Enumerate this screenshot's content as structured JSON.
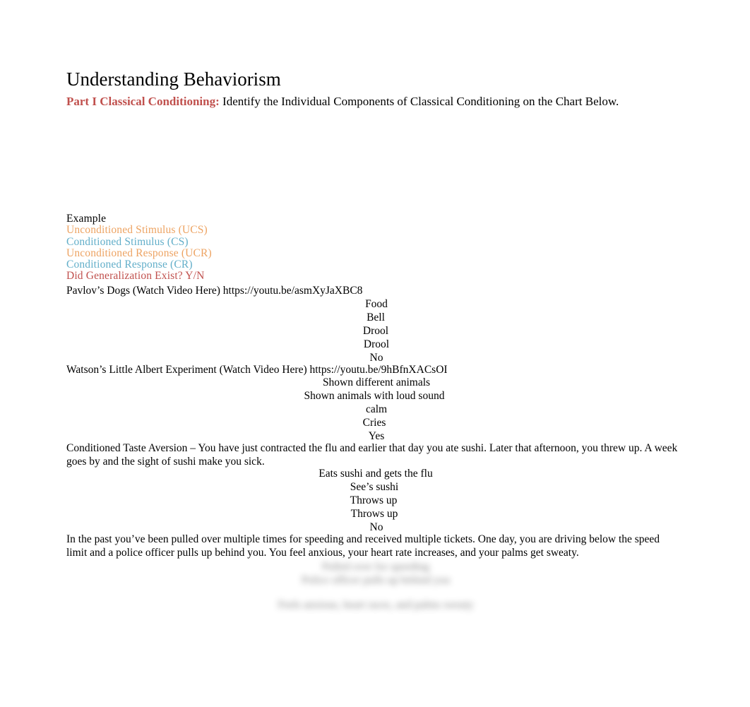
{
  "document": {
    "title": "Understanding Behaviorism",
    "subtitle_lead": "Part I Classical Conditioning:",
    "subtitle_rest": " Identify the Individual Components of Classical Conditioning on the Chart Below."
  },
  "colors": {
    "accent_red": "#c0504d",
    "accent_orange": "#eda362",
    "accent_blue": "#62aec9",
    "text_black": "#000000",
    "page_background": "#ffffff"
  },
  "legend": {
    "example_label": "Example",
    "items": [
      {
        "label": "Unconditioned Stimulus (UCS)",
        "color": "#eda362"
      },
      {
        "label": "Conditioned Stimulus (CS)",
        "color": "#62aec9"
      },
      {
        "label": "Unconditioned Response (UCR)",
        "color": "#eda362"
      },
      {
        "label": "Conditioned Response (CR)",
        "color": "#62aec9"
      },
      {
        "label": "Did Generalization Exist? Y/N",
        "color": "#c0504d"
      }
    ]
  },
  "scenarios": [
    {
      "heading": "Pavlov’s Dogs (Watch Video Here) https://youtu.be/asmXyJaXBC8",
      "answers": [
        "Food",
        "Bell",
        "Drool",
        "Drool",
        "No"
      ]
    },
    {
      "heading": "Watson’s Little Albert Experiment (Watch Video Here) https://youtu.be/9hBfnXACsOI",
      "answers": [
        "Shown different animals",
        "Shown animals with loud sound",
        "calm",
        "Cries",
        "Yes"
      ]
    },
    {
      "heading": "Conditioned Taste Aversion – You have just contracted the flu and earlier that day you ate sushi. Later that afternoon, you threw up. A week goes by and the sight of sushi make you sick.",
      "answers": [
        "Eats sushi and gets the flu",
        "See’s sushi",
        "Throws up",
        "Throws up",
        "No"
      ]
    },
    {
      "heading": "In the past you’ve been pulled over multiple times for speeding and received multiple tickets. One day, you are driving below the speed limit and a police officer pulls up behind you. You feel anxious, your heart rate increases, and your palms get sweaty.",
      "answers_redacted": true,
      "answers": [
        "Pulled over for speeding",
        "Police officer pulls up behind you",
        "",
        "Feels anxious, heart races, and palms sweaty"
      ]
    }
  ]
}
